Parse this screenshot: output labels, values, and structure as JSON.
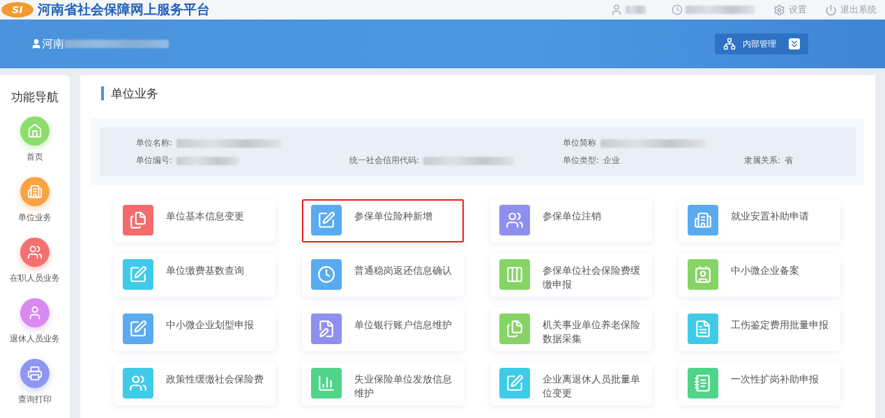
{
  "topbar": {
    "title": "河南省社会保障网上服务平台",
    "logo": "SI",
    "actions": [
      {
        "kind": "settings",
        "label": "设置"
      },
      {
        "kind": "logout",
        "label": "退出系统"
      }
    ]
  },
  "banner": {
    "user": "河南",
    "menu_button": "内部管理"
  },
  "sidebar": {
    "title": "功能导航",
    "items": [
      {
        "label": "首页",
        "kind": "home",
        "color": "#8fdc6e"
      },
      {
        "label": "单位业务",
        "kind": "building",
        "color": "#fba344"
      },
      {
        "label": "在职人员业务",
        "kind": "users",
        "color": "#f5706f"
      },
      {
        "label": "退休人员业务",
        "kind": "user",
        "color": "#d78bf0"
      },
      {
        "label": "查询打印",
        "kind": "printer",
        "color": "#8d96f2"
      }
    ]
  },
  "main": {
    "title": "单位业务",
    "info": [
      {
        "label": "单位名称:",
        "kind": "redacted"
      },
      {
        "label": "单位简称",
        "kind": "redacted"
      },
      {
        "label": "单位编号:",
        "kind": "redacted"
      },
      {
        "label": "统一社会信用代码:",
        "kind": "redacted"
      },
      {
        "label": "单位类型:",
        "value": "企业",
        "kind": "text"
      },
      {
        "label": "隶属关系:",
        "value": "省",
        "kind": "text"
      }
    ],
    "tiles": [
      {
        "label": "单位基本信息变更",
        "kind": "files",
        "color": "#f36b6b",
        "selected": false
      },
      {
        "label": "参保单位险种新增",
        "kind": "edit",
        "color": "#5aaaf0",
        "selected": true
      },
      {
        "label": "参保单位注销",
        "kind": "users",
        "color": "#8f8ff0",
        "selected": false
      },
      {
        "label": "就业安置补助申请",
        "kind": "building",
        "color": "#5aaaf0",
        "selected": false
      },
      {
        "label": "单位缴费基数查询",
        "kind": "edit",
        "color": "#3fcbe8",
        "selected": false
      },
      {
        "label": "普通稳岗返还信息确认",
        "kind": "clock",
        "color": "#5aaaf0",
        "selected": false
      },
      {
        "label": "参保单位社会保险费缓缴申报",
        "kind": "columns",
        "color": "#86d466",
        "selected": false
      },
      {
        "label": "中小微企业备案",
        "kind": "contact",
        "color": "#86d466",
        "selected": false
      },
      {
        "label": "中小微企业划型申报",
        "kind": "edit",
        "color": "#5aaaf0",
        "selected": false
      },
      {
        "label": "单位银行账户信息维护",
        "kind": "filepen",
        "color": "#8f8ff0",
        "selected": false
      },
      {
        "label": "机关事业单位养老保险数据采集",
        "kind": "files",
        "color": "#86d466",
        "selected": false
      },
      {
        "label": "工伤鉴定费用批量申报",
        "kind": "file",
        "color": "#3fcbe8",
        "selected": false
      },
      {
        "label": "政策性缓缴社会保险费",
        "kind": "users",
        "color": "#3fcbe8",
        "selected": false
      },
      {
        "label": "失业保险单位发放信息维护",
        "kind": "chart",
        "color": "#4fd48a",
        "selected": false
      },
      {
        "label": "企业离退休人员批量单位变更",
        "kind": "edit",
        "color": "#3fcbe8",
        "selected": false
      },
      {
        "label": "一次性扩岗补助申报",
        "kind": "notepad",
        "color": "#4fd48a",
        "selected": false
      }
    ]
  }
}
